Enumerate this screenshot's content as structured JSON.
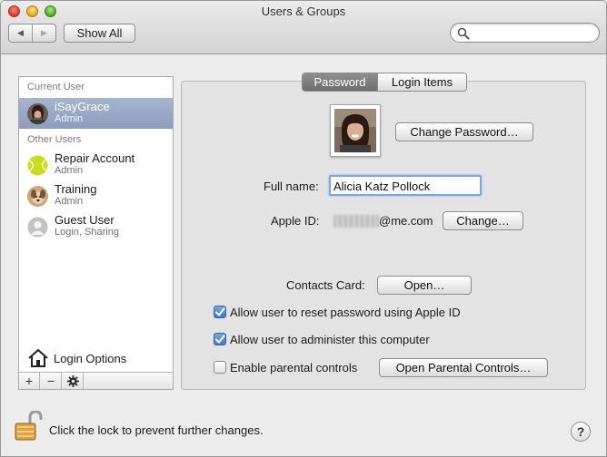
{
  "window": {
    "title": "Users & Groups"
  },
  "toolbar": {
    "back_icon": "chevron-left-icon",
    "forward_icon": "chevron-right-icon",
    "show_all_label": "Show All",
    "search_value": "",
    "search_placeholder": ""
  },
  "sidebar": {
    "current_user_header": "Current User",
    "other_users_header": "Other Users",
    "current_user": {
      "name": "iSayGrace",
      "role": "Admin",
      "avatar": "portrait-photo"
    },
    "other_users": [
      {
        "name": "Repair Account",
        "role": "Admin",
        "avatar": "tennis-ball-icon"
      },
      {
        "name": "Training",
        "role": "Admin",
        "avatar": "dog-photo"
      },
      {
        "name": "Guest User",
        "role": "Login, Sharing",
        "avatar": "generic-user-icon"
      }
    ],
    "login_options_label": "Login Options",
    "add_label": "+",
    "remove_label": "−",
    "gear_icon": "gear-icon"
  },
  "tabs": [
    {
      "label": "Password",
      "active": true
    },
    {
      "label": "Login Items",
      "active": false
    }
  ],
  "password_tab": {
    "change_password_label": "Change Password…",
    "full_name_label": "Full name:",
    "full_name_value": "Alicia Katz Pollock",
    "apple_id_label": "Apple ID:",
    "apple_id_suffix": "@me.com",
    "change_label": "Change…",
    "contacts_card_label": "Contacts Card:",
    "open_label": "Open…",
    "checkboxes": [
      {
        "label": "Allow user to reset password using Apple ID",
        "checked": true
      },
      {
        "label": "Allow user to administer this computer",
        "checked": true
      },
      {
        "label": "Enable parental controls",
        "checked": false
      }
    ],
    "open_parental_label": "Open Parental Controls…"
  },
  "footer": {
    "lock_text": "Click the lock to prevent further changes.",
    "help_label": "?"
  },
  "colors": {
    "selection": "#8c9cbb",
    "checkbox_on": "#3f76c9",
    "focus_ring": "#7aa7e0"
  }
}
